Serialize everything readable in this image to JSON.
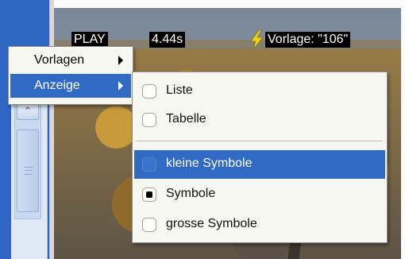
{
  "overlay": {
    "status": "PLAY",
    "time": "4.44s",
    "template": "Vorlage: \"106\""
  },
  "menu": {
    "items": [
      {
        "label": "Vorlagen",
        "has_submenu": true,
        "selected": false
      },
      {
        "label": "Anzeige",
        "has_submenu": true,
        "selected": true
      }
    ]
  },
  "submenu": {
    "items": [
      {
        "label": "Liste",
        "checked": false,
        "selected": false
      },
      {
        "label": "Tabelle",
        "checked": false,
        "selected": false
      },
      {
        "label": "kleine Symbole",
        "checked": false,
        "selected": true
      },
      {
        "label": "Symbole",
        "checked": true,
        "selected": false
      },
      {
        "label": "grosse Symbole",
        "checked": false,
        "selected": false
      }
    ]
  },
  "colors": {
    "selection": "#316ac5",
    "menu_background": "#f7f7f1",
    "frame_blue": "#2f66c4"
  },
  "icons": [
    "lightning-icon",
    "submenu-arrow-icon",
    "scroll-up-arrow-icon",
    "checkbox-icon"
  ]
}
